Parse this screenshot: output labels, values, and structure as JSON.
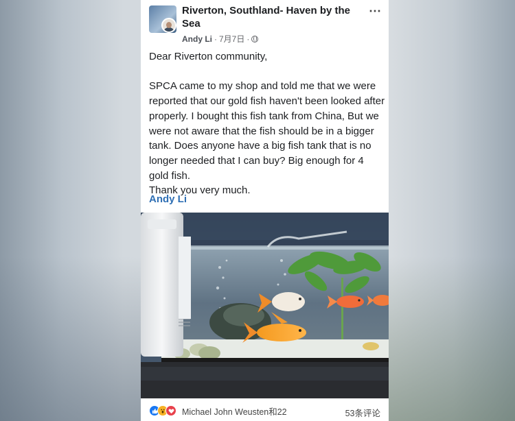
{
  "post": {
    "page_name": "Riverton, Southland- Haven by the Sea",
    "author": "Andy Li",
    "date": "7月7日",
    "separator": "·",
    "more_icon": "⋯",
    "audience_icon": "globe-icon",
    "body": "Dear Riverton community,\n\nSPCA came to my shop and told me that we were reported that our gold fish haven't been looked after properly. I bought this fish tank from China, But we were not aware that the fish should be in a bigger tank. Does anyone have a big fish tank that is no longer needed that I can buy? Big enough for 4  gold fish.\nThank you very much.",
    "signature": "Andy Li"
  },
  "photo": {
    "icon": "fish-tank-photo"
  },
  "footer": {
    "reaction_icons": [
      "like-icon",
      "wow-icon",
      "love-icon"
    ],
    "reactors": "Michael John Weusten和22",
    "comments": "53条评论"
  },
  "colors": {
    "link_blue": "#2f6fb4",
    "like_blue": "#1877f2",
    "wow_yellow": "#f7b125",
    "love_red": "#e8414c",
    "text_dark": "#1c1e21",
    "text_meta": "#65676b"
  }
}
